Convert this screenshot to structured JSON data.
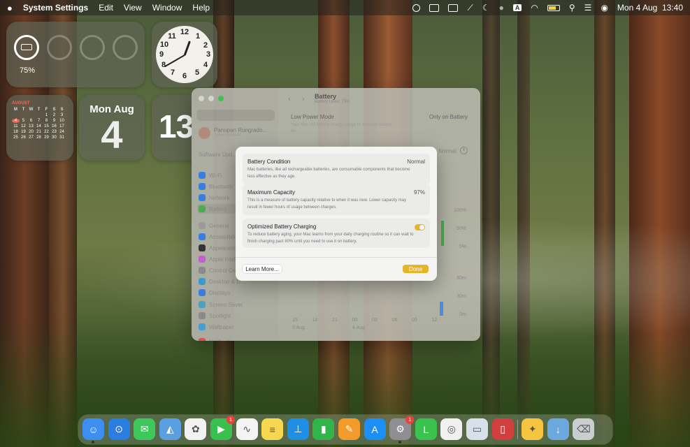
{
  "menubar": {
    "app_name": "System Settings",
    "menus": [
      "Edit",
      "View",
      "Window",
      "Help"
    ],
    "datetime": "Mon 4 Aug  13:40",
    "icons": [
      "apple-logo",
      "screen-record-icon",
      "keyboard-icon",
      "display-icon",
      "pen-icon",
      "moon-icon",
      "person-icon",
      "input-source-icon",
      "wifi-icon",
      "battery-icon",
      "search-icon",
      "control-center-icon",
      "siri-icon"
    ],
    "input_source_label": "A"
  },
  "widgets": {
    "battery_percent": "75%",
    "battery_level": 0.75,
    "clock_numbers": [
      "12",
      "1",
      "2",
      "3",
      "4",
      "5",
      "6",
      "7",
      "8",
      "9",
      "10",
      "11"
    ],
    "calendar": {
      "month": "AUGUST",
      "weekdays": [
        "M",
        "T",
        "W",
        "T",
        "F",
        "S",
        "S"
      ],
      "days": [
        "",
        "",
        "",
        "",
        "1",
        "2",
        "3",
        "4",
        "5",
        "6",
        "7",
        "8",
        "9",
        "10",
        "11",
        "12",
        "13",
        "14",
        "15",
        "16",
        "17",
        "18",
        "19",
        "20",
        "21",
        "22",
        "23",
        "24",
        "25",
        "26",
        "27",
        "28",
        "29",
        "30",
        "31"
      ],
      "today": "4"
    },
    "date_day_month": "Mon Aug",
    "date_number": "4",
    "digital_time": "13:4"
  },
  "settings": {
    "search_placeholder": "Search",
    "user_name": "Panupan Rungrado...",
    "user_sub": "Apple Account",
    "software_update": "Software Upd...",
    "sidebar_items": [
      "Wi-Fi",
      "Bluetooth",
      "Network",
      "Battery",
      "General",
      "Accessibili...",
      "Appearance",
      "Apple Intell...",
      "Control Cen...",
      "Desktop & D...",
      "Displays",
      "Screen Saver",
      "Spotlight",
      "Wallpaper",
      "Notifications"
    ],
    "title": "Battery",
    "subtitle": "Battery Level: 75%",
    "low_power_label": "Low Power Mode",
    "low_power_desc": "Your Mac will reduce energy usage to increase battery life.",
    "low_power_value": "Only on Battery",
    "health_value": "Normal",
    "pct_axis": [
      "100%",
      "50%",
      "0%"
    ],
    "min_axis": [
      "60m",
      "30m",
      "0m"
    ],
    "x_axis": [
      "15",
      "18",
      "21",
      "00",
      "03",
      "06",
      "09",
      "12"
    ],
    "x_dates": [
      "3 Aug",
      "4 Aug"
    ]
  },
  "dialog": {
    "sections": [
      {
        "title": "Battery Condition",
        "value": "Normal",
        "desc": "Mac batteries, like all rechargeable batteries, are consumable components that become less effective as they age."
      },
      {
        "title": "Maximum Capacity",
        "value": "97%",
        "desc": "This is a measure of battery capacity relative to when it was new. Lower capacity may result in fewer hours of usage between charges."
      },
      {
        "title": "Optimized Battery Charging",
        "desc": "To reduce battery aging, your Mac learns from your daily charging routine so it can wait to finish charging past 80% until you need to use it on battery."
      }
    ],
    "optimized_charging_on": true,
    "learn_more": "Learn More...",
    "done": "Done"
  },
  "dock": {
    "apps": [
      {
        "name": "finder-icon",
        "color": "#3d8ef0",
        "badge": "",
        "running": true
      },
      {
        "name": "safari-icon",
        "color": "#2a7de1",
        "badge": "",
        "running": false
      },
      {
        "name": "messages-icon",
        "color": "#3cc85a",
        "badge": "",
        "running": false
      },
      {
        "name": "maps-icon",
        "color": "#5aa0e0",
        "badge": "",
        "running": false
      },
      {
        "name": "photos-icon",
        "color": "#f2f2f2",
        "badge": "",
        "running": false
      },
      {
        "name": "facetime-icon",
        "color": "#39c04e",
        "badge": "1",
        "running": false
      },
      {
        "name": "freeform-icon",
        "color": "#f4f4f4",
        "badge": "",
        "running": false
      },
      {
        "name": "notes-icon",
        "color": "#f7d750",
        "badge": "",
        "running": false
      },
      {
        "name": "keynote-icon",
        "color": "#1f8fe6",
        "badge": "",
        "running": false
      },
      {
        "name": "numbers-icon",
        "color": "#2fb54a",
        "badge": "",
        "running": false
      },
      {
        "name": "pages-icon",
        "color": "#f39b2a",
        "badge": "",
        "running": false
      },
      {
        "name": "app-store-icon",
        "color": "#1c8ff5",
        "badge": "",
        "running": false
      },
      {
        "name": "system-settings-icon",
        "color": "#8e8e93",
        "badge": "1",
        "running": true
      },
      {
        "name": "line-icon",
        "color": "#3ac24e",
        "badge": "",
        "running": false
      },
      {
        "name": "chrome-icon",
        "color": "#f0f0f0",
        "badge": "",
        "running": false
      },
      {
        "name": "preview-icon",
        "color": "#d8e0ea",
        "badge": "",
        "running": false
      },
      {
        "name": "iphone-mirroring-icon",
        "color": "#d33f3f",
        "badge": "",
        "running": false
      },
      {
        "name": "tips-icon",
        "color": "#f5c542",
        "badge": "",
        "running": false
      },
      {
        "name": "downloads-folder-icon",
        "color": "#6aa8dd",
        "badge": "",
        "running": false
      },
      {
        "name": "trash-icon",
        "color": "#c9cdd0",
        "badge": "",
        "running": false
      }
    ]
  }
}
